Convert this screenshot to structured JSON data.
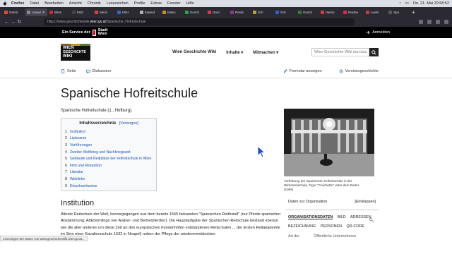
{
  "menubar": {
    "app": "Firefox",
    "items": [
      "Datei",
      "Bearbeiten",
      "Ansicht",
      "Chronik",
      "Lesezeichen",
      "Profile",
      "Extras",
      "Fenster",
      "Hilfe"
    ],
    "clock": "Do. 21. Mai  20:58:52"
  },
  "tabs": [
    {
      "label": "Gemit",
      "color": "#d5522f",
      "active": false
    },
    {
      "label": "Jasper Zi",
      "color": "#8a8a8a",
      "active": true
    },
    {
      "label": "Wien",
      "color": "#c03030",
      "active": false
    },
    {
      "label": "Mi2z",
      "color": "#444444",
      "active": false
    },
    {
      "label": "Meck",
      "color": "#d04444",
      "active": false
    },
    {
      "label": "HBU",
      "color": "#3a66c4",
      "active": false
    },
    {
      "label": "Kalend",
      "color": "#b0b0b0",
      "active": false
    },
    {
      "label": "Kalen",
      "color": "#c09030",
      "active": false
    },
    {
      "label": "Gesch",
      "color": "#30a050",
      "active": false
    },
    {
      "label": "Gesc",
      "color": "#d04040",
      "active": false
    },
    {
      "label": "Resta",
      "color": "#8a3a8a",
      "active": false
    },
    {
      "label": "Sch",
      "color": "#c0a030",
      "active": false
    },
    {
      "label": "Sch",
      "color": "#3060c0",
      "active": false
    },
    {
      "label": "Gesch",
      "color": "#308030",
      "active": false
    },
    {
      "label": "Versio",
      "color": "#d04040",
      "active": false
    },
    {
      "label": "Restau",
      "color": "#d03040",
      "active": false
    },
    {
      "label": "Aushi",
      "color": "#c04040",
      "active": false
    },
    {
      "label": "Spa",
      "color": "#5a5a5a",
      "active": false
    }
  ],
  "url": {
    "prefix": "https://www.geschichtewiki.",
    "host": "wien.gv.at",
    "path": "/Spanische_Hofreitschule"
  },
  "site_bar": {
    "service": "Ein Service der",
    "city_line1": "Stadt",
    "city_line2": "Wien",
    "login": "Anmelden"
  },
  "logo": {
    "line1": "WIEN",
    "line2": "GESCHICHTE",
    "line3": "WIKI"
  },
  "mainnav": [
    "Wien Geschichte Wiki",
    "Inhalte",
    "Mitmachen"
  ],
  "search": {
    "placeholder": "Wien Geschichte Wiki durchsu"
  },
  "subnav": {
    "page": "Seite",
    "discussion": "Diskussion",
    "show_form": "Formular anzeigen",
    "history": "Versionsgeschichte"
  },
  "title": "Spanische Hofreitschule",
  "lead": "Spanische Hofreitschule (1., Hofburg).",
  "toc": {
    "heading": "Inhaltsverzeichnis",
    "toggle": "[Verbergen]",
    "items": [
      {
        "n": "1",
        "t": "Institution"
      },
      {
        "n": "2",
        "t": "Lipizzaner"
      },
      {
        "n": "3",
        "t": "Vorführungen"
      },
      {
        "n": "4",
        "t": "Zweiter Weltkrieg und Nachkriegszeit"
      },
      {
        "n": "5",
        "t": "Gebäude und Reitplätze der Hofreitschule in Wien"
      },
      {
        "n": "6",
        "t": "Film und Rezeption"
      },
      {
        "n": "7",
        "t": "Literatur"
      },
      {
        "n": "8",
        "t": "Weblinks"
      },
      {
        "n": "9",
        "t": "Einzelnachweise"
      }
    ]
  },
  "figure": {
    "caption": "Vorführung der Spanischen Hofreitschule in der Winterreitschule, Figur \"Courbette\" unter dem Reiter (1955)"
  },
  "section": {
    "title": "Institution",
    "body": "Älteste Reitschule der Welt, hervorgegangen aus dem bereits 1565 bekannten \"Spanischen Reithstall\" (nur Pferde spanischer Abstammung; Abkömmlinge von Araber- und Berberpferden). Die Hauptaufgabe der Spanischen Reitschule bestand ebenso wie die aller anderen um diese Zeit an den europäischen Fürstenhöfen entstandenen Reitschulen ... der Ersten Reitakademie im Sinn einer Kavaliersschule 1532 in Neapel) neben der Pflege der wiedererentdeckten"
  },
  "databox": {
    "heading": "Daten zur Organisation",
    "toggle": "[Einklappen]",
    "tabs": [
      "ORGANISATIONSDATEN",
      "BILD",
      "ADRESSEN",
      "BEZEICHNUNG",
      "PERSONEN",
      "QR-CODE"
    ],
    "row_label": "Art der",
    "row_value": "Öffentliche Unternehmen"
  },
  "statusbar": "Lesezeigen der Daten von www.geschichtewiki.wien.gv.at..."
}
